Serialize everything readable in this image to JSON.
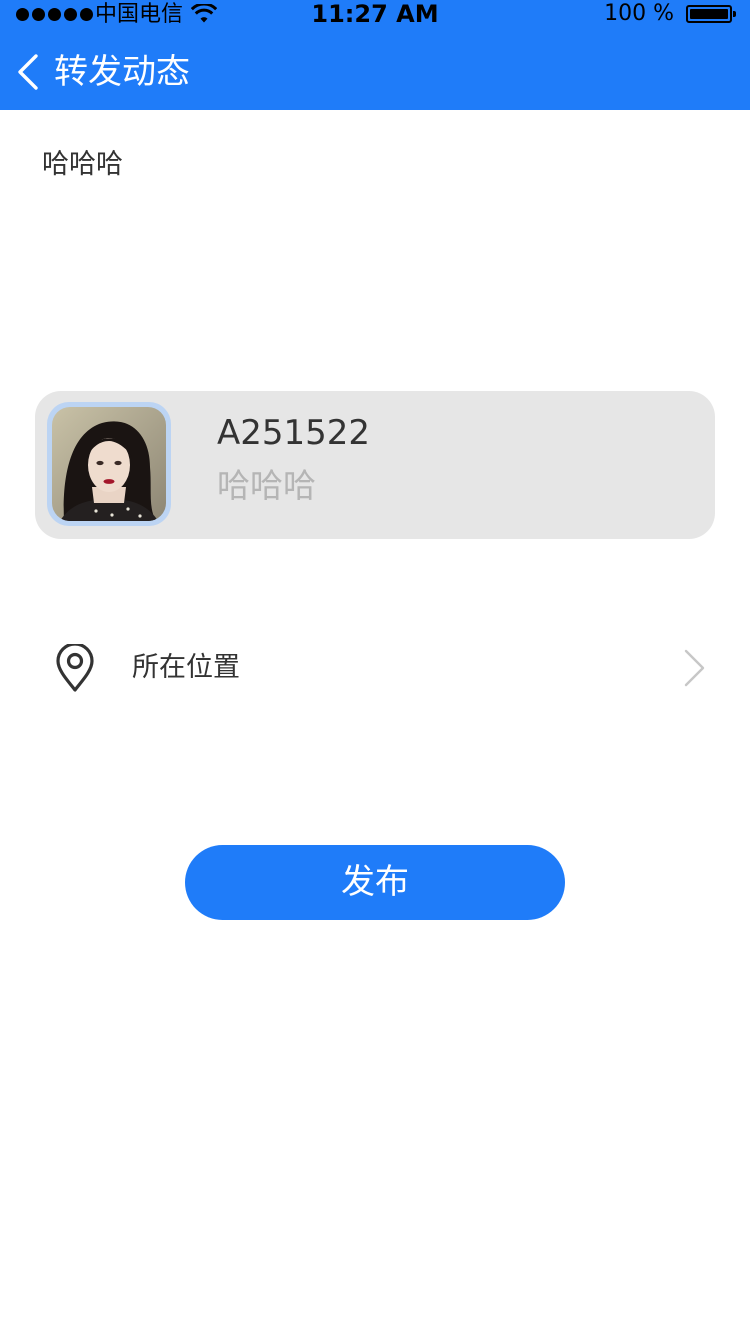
{
  "status_bar": {
    "carrier": "中国电信",
    "time": "11:27 AM",
    "battery": "100 %"
  },
  "nav": {
    "title": "转发动态",
    "back_icon": "chevron-left-icon"
  },
  "compose": {
    "text": "哈哈哈"
  },
  "shared_post": {
    "username": "A251522",
    "content": "哈哈哈",
    "avatar": "avatar-photo"
  },
  "location": {
    "label": "所在位置",
    "icon": "location-pin-icon",
    "arrow_icon": "chevron-right-icon"
  },
  "publish": {
    "label": "发布"
  },
  "colors": {
    "accent": "#1f7cf9",
    "card_bg": "#e6e6e6",
    "muted_text": "#b5b5b5",
    "text": "#333333"
  }
}
